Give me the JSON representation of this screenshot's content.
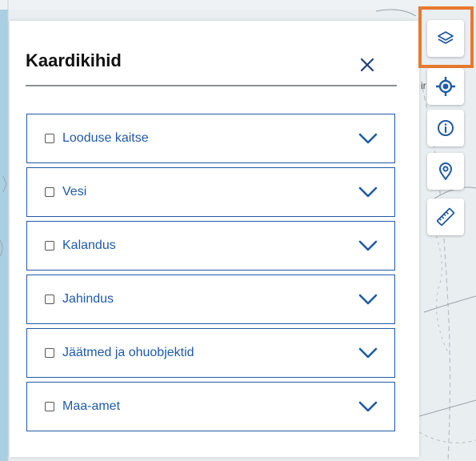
{
  "panel": {
    "title": "Kaardikihid",
    "close_icon": "close-icon"
  },
  "layers": [
    {
      "label": "Looduse kaitse",
      "checked": false
    },
    {
      "label": "Vesi",
      "checked": false
    },
    {
      "label": "Kalandus",
      "checked": false
    },
    {
      "label": "Jahindus",
      "checked": false
    },
    {
      "label": "Jäätmed ja ohuobjektid",
      "checked": false
    },
    {
      "label": "Maa-amet",
      "checked": false
    }
  ],
  "toolbar": {
    "items": [
      {
        "icon": "layers-icon",
        "active": true
      },
      {
        "icon": "locate-icon"
      },
      {
        "icon": "info-icon"
      },
      {
        "icon": "location-pin-icon"
      },
      {
        "icon": "ruler-icon"
      }
    ]
  },
  "map_fragment_label": "ir",
  "colors": {
    "accent": "#1f5aa6",
    "highlight": "#e67a2e",
    "map_water": "#a9cfe3"
  }
}
